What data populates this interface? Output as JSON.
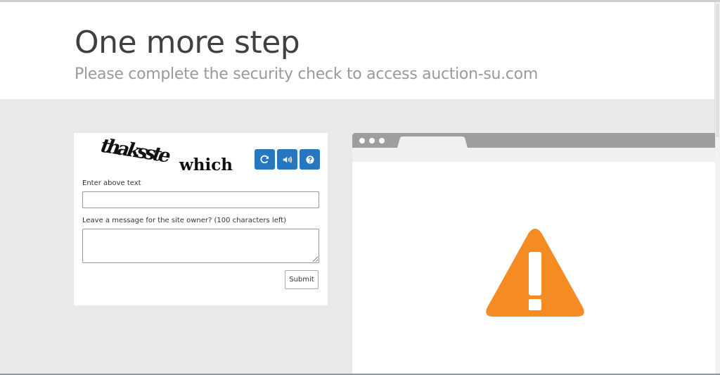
{
  "header": {
    "title": "One more step",
    "subtitle": "Please complete the security check to access auction-su.com"
  },
  "captcha": {
    "image_words": [
      "thaksste",
      "which"
    ],
    "buttons": [
      {
        "name": "refresh",
        "icon": "refresh-icon"
      },
      {
        "name": "audio",
        "icon": "speaker-icon"
      },
      {
        "name": "help",
        "icon": "question-icon"
      }
    ],
    "button_color": "#2677bf",
    "input_label": "Enter above text",
    "input_value": "",
    "message_label": "Leave a message for the site owner? (100 characters left)",
    "message_value": "",
    "submit_label": "Submit"
  },
  "browser_mock": {
    "bar_color": "#9e9e9e",
    "warning_color": "#f48c23",
    "icon": "warning-triangle-icon"
  }
}
